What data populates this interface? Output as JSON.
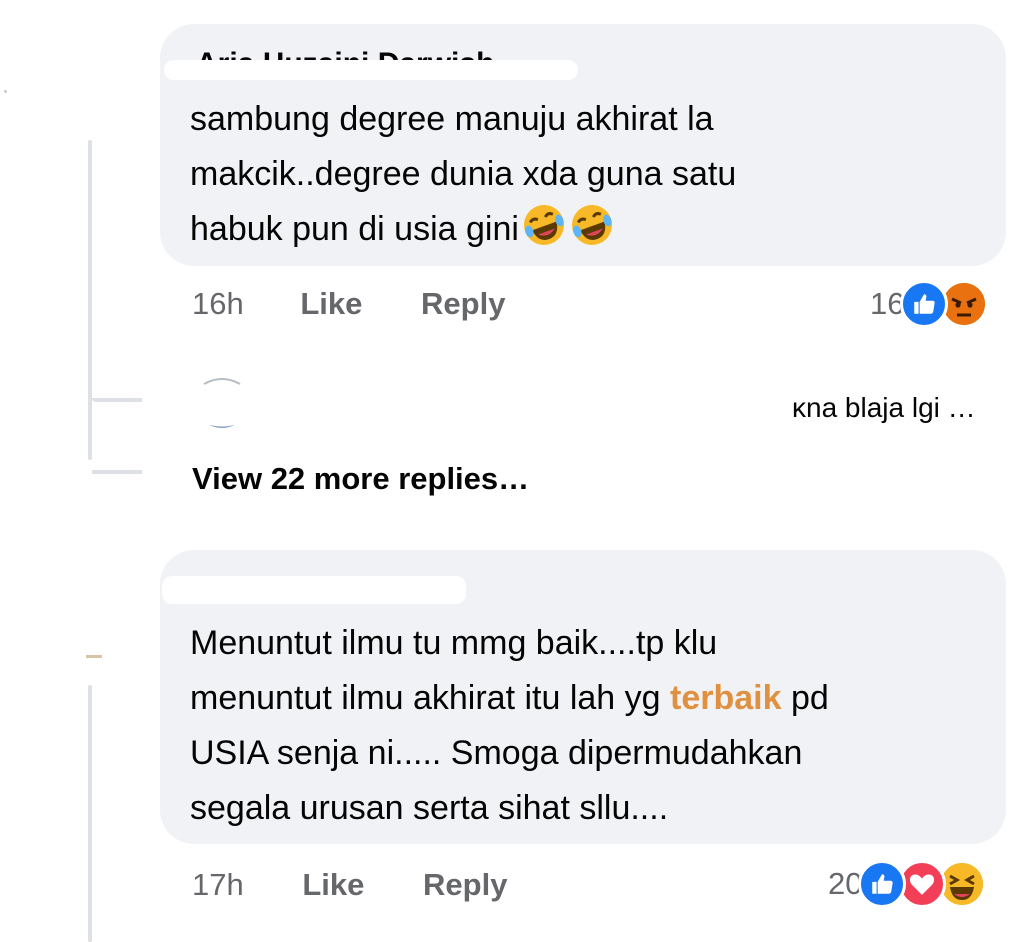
{
  "comments": [
    {
      "author_visible": "Aria Huzaini Darwish",
      "text_lines": [
        "sambung degree manuju akhirat la",
        "makcik..degree dunia xda guna satu",
        "habuk pun di usia gini"
      ],
      "time": "16h",
      "like_label": "Like",
      "reply_label": "Reply",
      "reaction_count": "16",
      "reactions": [
        "like-icon",
        "angry-icon"
      ],
      "inline_emoji": [
        "rofl-emoji",
        "rofl-emoji"
      ]
    },
    {
      "text_lines": [
        "Menuntut ilmu tu mmg baik....tp klu",
        "menuntut ilmu akhirat itu lah yg ",
        "USIA senja ni..... Smoga dipermudahkan",
        "segala urusan serta sihat sllu...."
      ],
      "highlight_word": "terbaik",
      "after_highlight": " pd",
      "time": "17h",
      "like_label": "Like",
      "reply_label": "Reply",
      "reaction_count": "20",
      "reactions": [
        "like-icon",
        "love-icon",
        "haha-icon"
      ]
    }
  ],
  "reply_preview": {
    "snippet": "ĸna blaja lgi …"
  },
  "view_more": "View 22 more replies…",
  "colors": {
    "bubble": "#f0f2f5",
    "meta": "#65676b",
    "highlight": "#e0913f",
    "like_blue": "#1877f2",
    "love_red": "#f33e58",
    "angry_orange": "#e9710f",
    "haha_yellow": "#f7b928"
  }
}
